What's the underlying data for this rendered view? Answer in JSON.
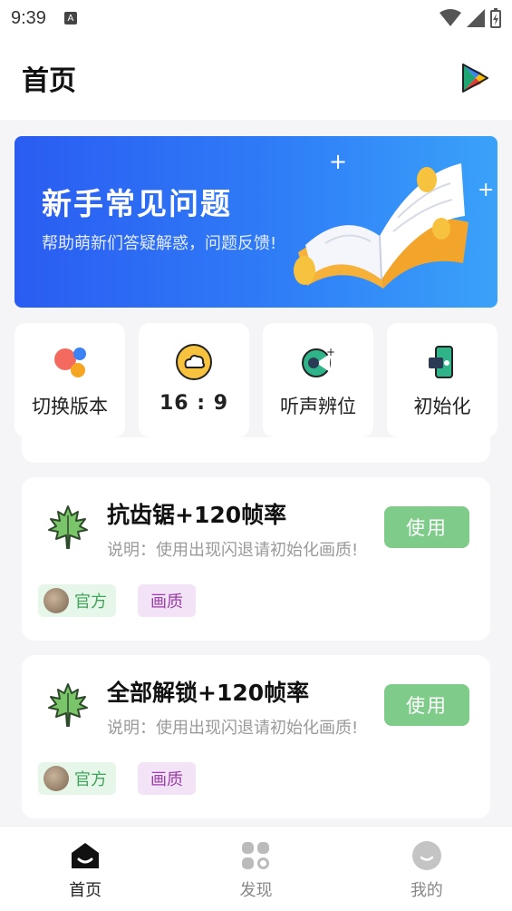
{
  "status": {
    "time": "9:39",
    "a_icon": "A"
  },
  "app_bar": {
    "title": "首页",
    "play_icon": "play-store-icon"
  },
  "banner": {
    "title": "新手常见问题",
    "subtitle": "帮助萌新们答疑解惑，问题反馈!"
  },
  "quick": [
    {
      "label": "切换版本",
      "icon": "switch-version-icon"
    },
    {
      "label": "16 : 9",
      "icon": "cloud-icon"
    },
    {
      "label": "听声辨位",
      "icon": "sound-locate-icon"
    },
    {
      "label": "初始化",
      "icon": "reset-icon"
    }
  ],
  "items": [
    {
      "title": "抗齿锯+120帧率",
      "desc": "说明：使用出现闪退请初始化画质!",
      "button": "使用",
      "tag_official": "官方",
      "tag_quality": "画质"
    },
    {
      "title": "全部解锁+120帧率",
      "desc": "说明：使用出现闪退请初始化画质!",
      "button": "使用",
      "tag_official": "官方",
      "tag_quality": "画质"
    }
  ],
  "nav": [
    {
      "label": "首页",
      "icon": "home-icon",
      "active": true
    },
    {
      "label": "发现",
      "icon": "discover-icon",
      "active": false
    },
    {
      "label": "我的",
      "icon": "profile-icon",
      "active": false
    }
  ],
  "colors": {
    "accent_green": "#7fcc8a",
    "banner_blue": "#2f7df7",
    "tag_green": "#3fa55a",
    "tag_purple": "#9b3fa8"
  }
}
